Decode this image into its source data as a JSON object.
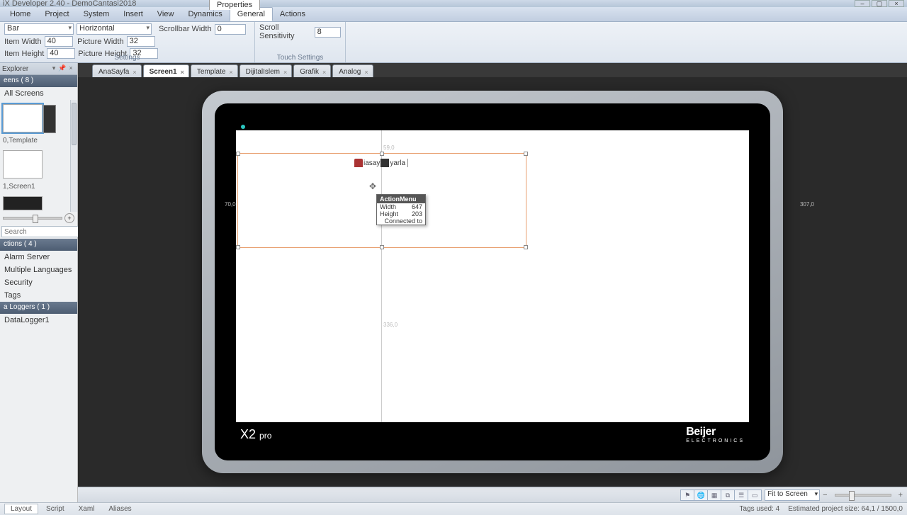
{
  "window": {
    "title": "iX Developer 2.40 - DemoCantasi2018",
    "properties_tab": "Properties"
  },
  "menu": {
    "items": [
      "Home",
      "Project",
      "System",
      "Insert",
      "View",
      "Dynamics",
      "General",
      "Actions"
    ],
    "active": "General"
  },
  "ribbon": {
    "group_settings": "Settings",
    "group_touch": "Touch Settings",
    "bar_combo": "Bar",
    "orientation_combo": "Horizontal",
    "item_width_label": "Item Width",
    "item_width": "40",
    "item_height_label": "Item Height",
    "item_height": "40",
    "picture_width_label": "Picture Width",
    "picture_width": "32",
    "picture_height_label": "Picture Height",
    "picture_height": "32",
    "scrollbar_width_label": "Scrollbar Width",
    "scrollbar_width": "0",
    "scroll_sensitivity_label": "Scroll Sensitivity",
    "scroll_sensitivity": "8"
  },
  "explorer": {
    "title": "Explorer",
    "screens_header": "eens ( 8 )",
    "all_screens": "All Screens",
    "thumbs": [
      {
        "label": "0,Template"
      },
      {
        "label": "1,Screen1"
      }
    ],
    "search_placeholder": "Search",
    "functions_header": "ctions ( 4 )",
    "functions": [
      "Alarm Server",
      "Multiple Languages",
      "Security",
      "Tags"
    ],
    "loggers_header": "a Loggers ( 1 )",
    "loggers": [
      "DataLogger1"
    ]
  },
  "tabs": [
    {
      "label": "AnaSayfa"
    },
    {
      "label": "Screen1",
      "active": true
    },
    {
      "label": "Template"
    },
    {
      "label": "DijitalIslem"
    },
    {
      "label": "Grafik"
    },
    {
      "label": "Analog"
    }
  ],
  "device": {
    "brand_model": "X2",
    "brand_variant": "pro",
    "brand_company": "Beijer",
    "brand_sub": "ELECTRONICS"
  },
  "design": {
    "placed_label_a": "iasay",
    "placed_label_b": "yarla",
    "guide_top": "59,0",
    "guide_left": "70,0",
    "guide_right": "307,0",
    "guide_bottom": "336,0"
  },
  "tooltip": {
    "header": "ActionMenu",
    "rows": [
      {
        "k": "Width",
        "v": "647"
      },
      {
        "k": "Height",
        "v": "203"
      },
      {
        "k": "Connected to",
        "v": ""
      }
    ]
  },
  "canvas_status": {
    "fit": "Fit to Screen"
  },
  "app_status": {
    "views": [
      "Layout",
      "Script",
      "Xaml",
      "Aliases"
    ],
    "tags_used": "Tags used: 4",
    "project_size": "Estimated project size: 64,1 / 1500,0"
  }
}
